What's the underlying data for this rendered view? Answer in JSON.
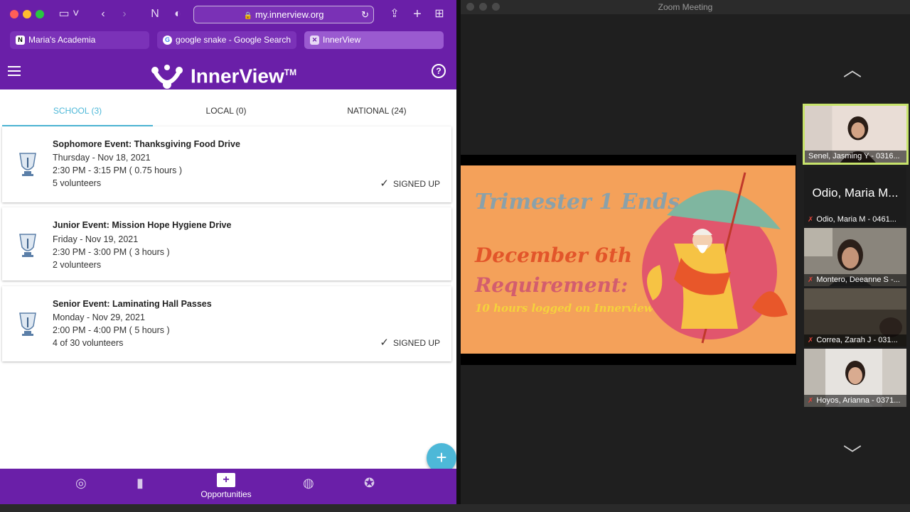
{
  "browser": {
    "url": "my.innerview.org",
    "tabs": [
      {
        "label": "Maria's Academia"
      },
      {
        "label": "google snake - Google Search"
      },
      {
        "label": "InnerView"
      }
    ]
  },
  "app": {
    "brand": "InnerView",
    "brand_tm": "TM",
    "help": "?",
    "tabs": [
      {
        "label": "SCHOOL (3)"
      },
      {
        "label": "LOCAL (0)"
      },
      {
        "label": "NATIONAL (24)"
      }
    ],
    "events": [
      {
        "title": "Sophomore Event: Thanksgiving Food Drive",
        "date": "Thursday - Nov 18, 2021",
        "time": "2:30 PM - 3:15 PM ( 0.75 hours )",
        "volunteers": "5 volunteers",
        "status": "SIGNED UP"
      },
      {
        "title": "Junior Event: Mission Hope Hygiene Drive",
        "date": "Friday - Nov 19, 2021",
        "time": "2:30 PM - 3:00 PM ( 3 hours )",
        "volunteers": "2 volunteers",
        "status": ""
      },
      {
        "title": "Senior Event: Laminating Hall Passes",
        "date": "Monday - Nov 29, 2021",
        "time": "2:00 PM - 4:00 PM ( 5 hours )",
        "volunteers": "4 of 30 volunteers",
        "status": "SIGNED UP"
      }
    ],
    "fab": "+",
    "bottom_nav": {
      "active_label": "Opportunities"
    }
  },
  "zoom": {
    "title": "Zoom Meeting",
    "slide": {
      "line1": "Trimester 1 Ends...",
      "line2": "December 6th",
      "line3": "Requirement:",
      "line4": "10 hours logged on Innerview"
    },
    "participants": [
      {
        "name": "Senel, Jasming Y - 0316...",
        "big": "",
        "muted": false
      },
      {
        "name": "Odio, Maria M - 0461...",
        "big": "Odio, Maria M...",
        "muted": true
      },
      {
        "name": "Montero, Deeanne S -...",
        "big": "",
        "muted": true
      },
      {
        "name": "Correa, Zarah J - 031...",
        "big": "",
        "muted": true
      },
      {
        "name": "Hoyos, Arianna - 0371...",
        "big": "",
        "muted": true
      }
    ]
  }
}
